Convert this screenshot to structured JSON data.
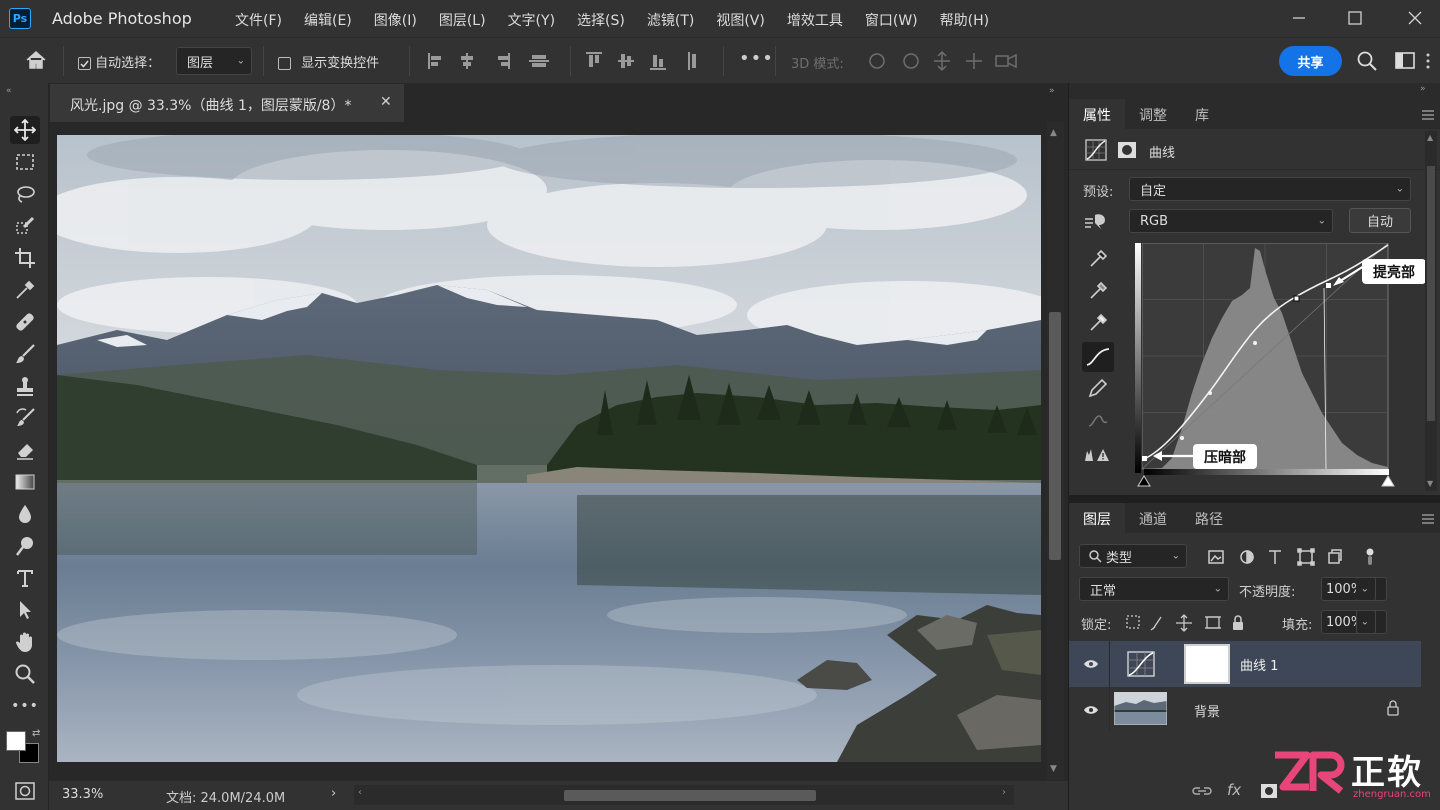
{
  "app": {
    "logo": "Ps",
    "title": "Adobe Photoshop"
  },
  "menu": [
    "文件(F)",
    "编辑(E)",
    "图像(I)",
    "图层(L)",
    "文字(Y)",
    "选择(S)",
    "滤镜(T)",
    "视图(V)",
    "增效工具",
    "窗口(W)",
    "帮助(H)"
  ],
  "options": {
    "auto_select_label": "自动选择：",
    "auto_select_value": "图层",
    "show_transform_label": "显示变换控件",
    "mode3d_label": "3D 模式:",
    "share_label": "共享"
  },
  "document": {
    "tab_title": "风光.jpg @ 33.3%（曲线 1，图层蒙版/8）*"
  },
  "status": {
    "zoom": "33.3%",
    "doc_info": "文档: 24.0M/24.0M"
  },
  "properties": {
    "tabs": [
      "属性",
      "调整",
      "库"
    ],
    "active_tab": "属性",
    "title": "曲线",
    "preset_label": "预设:",
    "preset_value": "自定",
    "channel_value": "RGB",
    "auto_label": "自动",
    "callout_highlight": "提亮部",
    "callout_shadow": "压暗部"
  },
  "layers": {
    "tabs": [
      "图层",
      "通道",
      "路径"
    ],
    "filter_value": "类型",
    "blend_mode": "正常",
    "opacity_label": "不透明度:",
    "opacity_value": "100%",
    "lock_label": "锁定:",
    "fill_label": "填充:",
    "fill_value": "100%",
    "items": [
      {
        "name": "曲线 1",
        "selected": true
      },
      {
        "name": "背景",
        "selected": false,
        "locked": true
      }
    ]
  },
  "watermark": {
    "brand": "ZR",
    "text": "正软",
    "url": "zhengruan.com"
  },
  "colors": {
    "accent": "#1473e6",
    "panel": "#323232",
    "dark": "#1e1e1e",
    "selected_layer": "#3e4757"
  },
  "icons": [
    "home-icon",
    "move-icon",
    "marquee-icon",
    "lasso-icon",
    "quick-select-icon",
    "crop-icon",
    "eyedropper-icon",
    "healing-icon",
    "brush-icon",
    "stamp-icon",
    "history-brush-icon",
    "eraser-icon",
    "gradient-icon",
    "blur-icon",
    "dodge-icon",
    "type-icon",
    "path-select-icon",
    "hand-icon",
    "zoom-icon",
    "more-icon",
    "search-icon",
    "eye-icon",
    "lock-icon"
  ]
}
